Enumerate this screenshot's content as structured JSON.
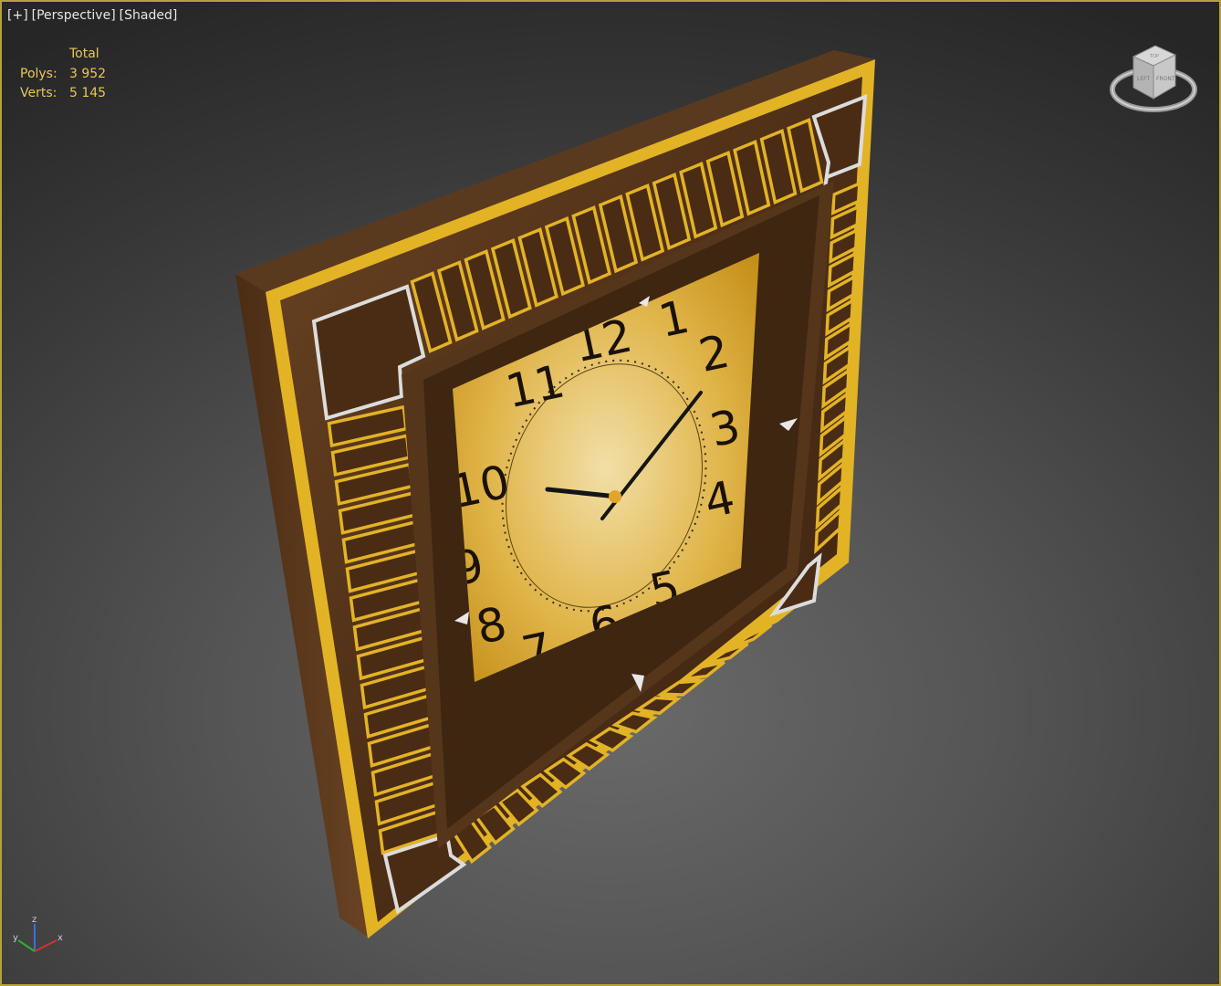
{
  "viewport": {
    "labels": [
      "[+]",
      "[Perspective]",
      "[Shaded]"
    ],
    "border_color": "#b8a03a"
  },
  "stats": {
    "header": "Total",
    "polys_label": "Polys:",
    "polys_value": "3 952",
    "verts_label": "Verts:",
    "verts_value": "5 145"
  },
  "viewcube": {
    "icon": "viewcube-icon",
    "faces": [
      "TOP",
      "LEFT",
      "FRONT"
    ]
  },
  "axis_tripod": {
    "icon": "axis-tripod-icon",
    "x": "x",
    "y": "y",
    "z": "z"
  },
  "clock": {
    "numerals": [
      "12",
      "1",
      "2",
      "3",
      "4",
      "5",
      "6",
      "7",
      "8",
      "9",
      "10",
      "11"
    ],
    "frame_color": "#5a3a1c",
    "gold_color": "#e3b326",
    "silver_color": "#d8d8d8"
  }
}
